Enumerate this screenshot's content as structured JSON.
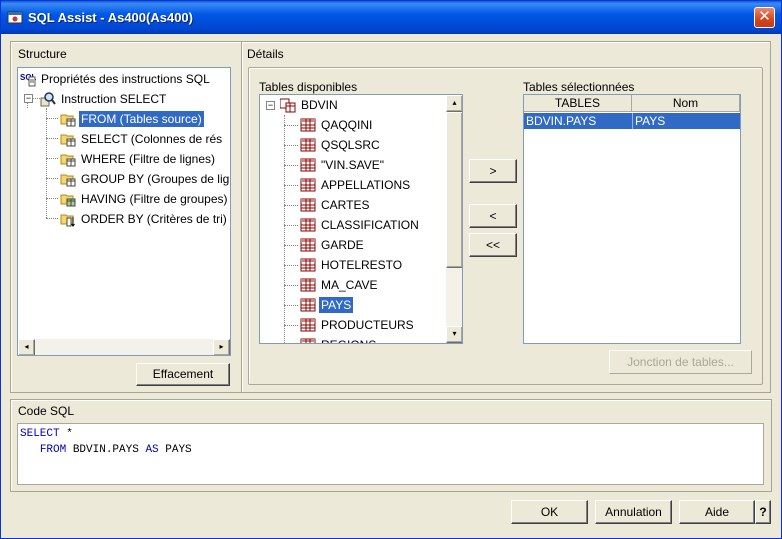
{
  "window": {
    "title": "SQL Assist - As400(As400)",
    "close_glyph": "✕"
  },
  "structure": {
    "label": "Structure",
    "clear_button": "Effacement",
    "tree": [
      {
        "label": "Propriétés des instructions SQL",
        "icon": "sql-properties-icon"
      },
      {
        "label": "Instruction SELECT",
        "icon": "select-statement-icon"
      },
      {
        "label": "FROM (Tables source)",
        "icon": "folder-table-icon",
        "selected": true
      },
      {
        "label": "SELECT (Colonnes de rés",
        "icon": "folder-table-icon"
      },
      {
        "label": "WHERE (Filtre de lignes)",
        "icon": "folder-table-icon"
      },
      {
        "label": "GROUP BY (Groupes de lig",
        "icon": "folder-table-icon"
      },
      {
        "label": "HAVING (Filtre de groupes)",
        "icon": "folder-table-icon"
      },
      {
        "label": "ORDER BY (Critères de tri)",
        "icon": "folder-sort-icon"
      }
    ]
  },
  "details": {
    "label": "Détails",
    "available_label": "Tables disponibles",
    "selected_label": "Tables sélectionnées",
    "library": "BDVIN",
    "tables": [
      "QAQQINI",
      "QSQLSRC",
      "\"VIN.SAVE\"",
      "APPELLATIONS",
      "CARTES",
      "CLASSIFICATION",
      "GARDE",
      "HOTELRESTO",
      "MA_CAVE",
      "PAYS",
      "PRODUCTEURS",
      "REGIONS"
    ],
    "selected_table_index": 9,
    "buttons": {
      "add": ">",
      "remove": "<",
      "remove_all": "<<"
    },
    "selected_columns": {
      "tables": "TABLES",
      "name": "Nom"
    },
    "selected_rows": [
      {
        "table": "BDVIN.PAYS",
        "name": "PAYS"
      }
    ],
    "join_button": "Jonction de tables..."
  },
  "sql_code": {
    "label": "Code SQL",
    "line1_kw": "SELECT",
    "line1_rest": " *",
    "line2_kw": "FROM",
    "line2_mid": " BDVIN.PAYS ",
    "line2_kw2": "AS",
    "line2_rest": " PAYS"
  },
  "footer": {
    "ok": "OK",
    "cancel": "Annulation",
    "help": "Aide",
    "context_help": "?"
  },
  "colors": {
    "selection": "#316ac5",
    "keyword": "#0000c0",
    "titlebar": "#0058e6"
  }
}
